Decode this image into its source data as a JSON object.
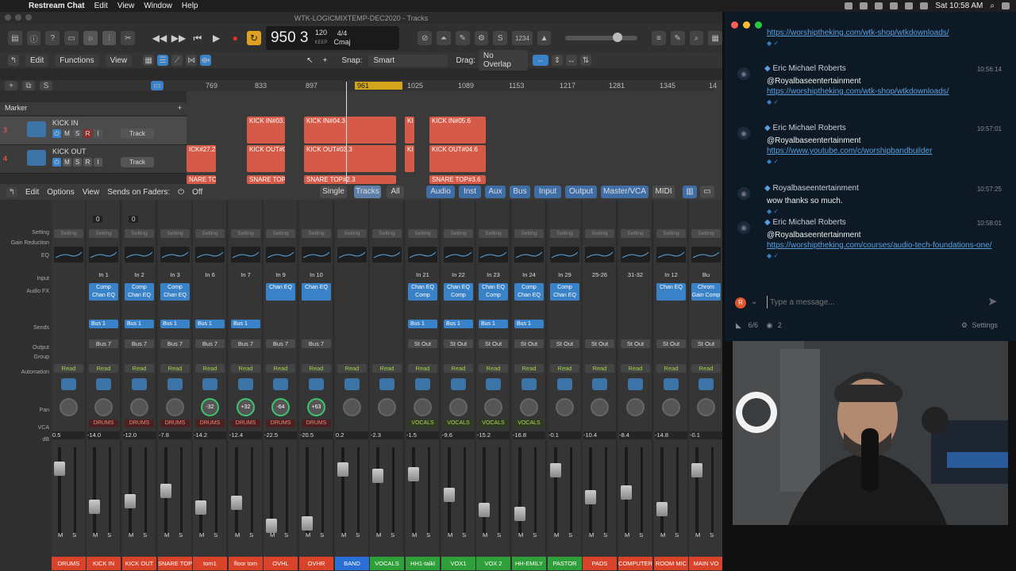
{
  "menubar": {
    "app": "Restream Chat",
    "items": [
      "Edit",
      "View",
      "Window",
      "Help"
    ],
    "time": "Sat 10:58 AM"
  },
  "logic": {
    "title": "WTK-LOGICMIXTEMP-DEC2020 - Tracks",
    "lcd": {
      "position": "950 3",
      "bar": "BAR",
      "beat": "BEAT",
      "tempo": "120",
      "keep": "KEEP",
      "tempo_label": "TEMPO",
      "sig": "4/4",
      "key": "Cmaj",
      "counter": "1234"
    },
    "edit": {
      "edit": "Edit",
      "functions": "Functions",
      "view": "View",
      "snap_label": "Snap:",
      "snap": "Smart",
      "drag_label": "Drag:",
      "drag": "No Overlap"
    },
    "ruler": [
      "769",
      "833",
      "897",
      "961",
      "1025",
      "1089",
      "1153",
      "1217",
      "1281",
      "1345",
      "14"
    ],
    "marker": "Marker",
    "tracks": [
      {
        "num": "3",
        "name": "KICK IN",
        "btn": "Track"
      },
      {
        "num": "4",
        "name": "KICK OUT",
        "btn": "Track"
      }
    ],
    "regions": [
      "KICK IN#03.",
      "KICK IN#04.3",
      "KI",
      "KICK IN#05.6",
      "ICK#27.2",
      "KICK OUT#0",
      "KICK OUT#03.3",
      "KI",
      "KICK OUT#04.6",
      "NARE TO",
      "SNARE TOP",
      "SNARE TOP#2.3",
      "SNARE TOP#3.6"
    ]
  },
  "mixer": {
    "bar": {
      "edit": "Edit",
      "options": "Options",
      "view": "View",
      "sends": "Sends on Faders:",
      "off": "Off",
      "single": "Single",
      "tracks": "Tracks",
      "all": "All",
      "tabs": [
        "Audio",
        "Inst",
        "Aux",
        "Bus",
        "Input",
        "Output",
        "Master/VCA",
        "MIDI"
      ]
    },
    "labels": [
      "Setting",
      "Gain Reduction",
      "EQ",
      "Input",
      "Audio FX",
      "Sends",
      "Output",
      "Group",
      "Automation",
      "Pan",
      "VCA",
      "dB"
    ],
    "gr_values": [
      "0",
      "0"
    ],
    "strips": [
      {
        "name": "DRUMS",
        "color": "#d9432a",
        "input": "",
        "fx": "",
        "send": "",
        "out": "",
        "auto": "Read",
        "vca": "",
        "db": "0.5",
        "pan": ""
      },
      {
        "name": "KICK IN",
        "color": "#d9432a",
        "input": "In 1",
        "fx": "Comp Chan EQ",
        "send": "Bus 1",
        "out": "Bus 7",
        "auto": "Read",
        "vca": "DRUMS",
        "db": "-14.0",
        "pan": ""
      },
      {
        "name": "KICK OUT",
        "color": "#d9432a",
        "input": "In 2",
        "fx": "Comp Chan EQ",
        "send": "Bus 1",
        "out": "Bus 7",
        "auto": "Read",
        "vca": "DRUMS",
        "db": "-12.0",
        "pan": ""
      },
      {
        "name": "SNARE TOP",
        "color": "#d9432a",
        "input": "In 3",
        "fx": "Comp Chan EQ",
        "send": "Bus 1",
        "out": "Bus 7",
        "auto": "Read",
        "vca": "DRUMS",
        "db": "-7.8",
        "pan": ""
      },
      {
        "name": "tom1",
        "color": "#d9432a",
        "input": "In 6",
        "fx": "",
        "send": "Bus 1",
        "out": "Bus 7",
        "auto": "Read",
        "vca": "DRUMS",
        "db": "-14.2",
        "pan": "-32"
      },
      {
        "name": "floor tom",
        "color": "#d9432a",
        "input": "In 7",
        "fx": "",
        "send": "Bus 1",
        "out": "Bus 7",
        "auto": "Read",
        "vca": "DRUMS",
        "db": "-12.4",
        "pan": "+32"
      },
      {
        "name": "OVHL",
        "color": "#d9432a",
        "input": "In 9",
        "fx": "Chan EQ",
        "send": "",
        "out": "Bus 7",
        "auto": "Read",
        "vca": "DRUMS",
        "db": "-22.5",
        "pan": "-64"
      },
      {
        "name": "OVHR",
        "color": "#d9432a",
        "input": "In 10",
        "fx": "Chan EQ",
        "send": "",
        "out": "Bus 7",
        "auto": "Read",
        "vca": "DRUMS",
        "db": "-20.5",
        "pan": "+63"
      },
      {
        "name": "BAND",
        "color": "#2a6fd6",
        "input": "",
        "fx": "",
        "send": "",
        "out": "",
        "auto": "Read",
        "vca": "",
        "db": "0.2",
        "pan": ""
      },
      {
        "name": "VOCALS",
        "color": "#2f9f3a",
        "input": "",
        "fx": "",
        "send": "",
        "out": "",
        "auto": "Read",
        "vca": "",
        "db": "-2.3",
        "pan": ""
      },
      {
        "name": "HH1-talkl",
        "color": "#2f9f3a",
        "input": "In 21",
        "fx": "Chan EQ Comp",
        "send": "Bus 1",
        "out": "St Out",
        "auto": "Read",
        "vca": "VOCALS",
        "db": "-1.5",
        "pan": ""
      },
      {
        "name": "VOX1",
        "color": "#2f9f3a",
        "input": "In 22",
        "fx": "Chan EQ Comp",
        "send": "Bus 1",
        "out": "St Out",
        "auto": "Read",
        "vca": "VOCALS",
        "db": "-9.6",
        "pan": ""
      },
      {
        "name": "VOX 2",
        "color": "#2f9f3a",
        "input": "In 23",
        "fx": "Chan EQ Comp",
        "send": "Bus 1",
        "out": "St Out",
        "auto": "Read",
        "vca": "VOCALS",
        "db": "-15.2",
        "pan": ""
      },
      {
        "name": "HH-EMILY",
        "color": "#2f9f3a",
        "input": "In 24",
        "fx": "Comp Chan EQ",
        "send": "Bus 1",
        "out": "St Out",
        "auto": "Read",
        "vca": "VOCALS",
        "db": "-16.8",
        "pan": ""
      },
      {
        "name": "PASTOR",
        "color": "#2f9f3a",
        "input": "In 29",
        "fx": "Comp Chan EQ",
        "send": "",
        "out": "St Out",
        "auto": "Read",
        "vca": "",
        "db": "-0.1",
        "pan": ""
      },
      {
        "name": "PADS",
        "color": "#d9432a",
        "input": "25-26",
        "fx": "",
        "send": "",
        "out": "St Out",
        "auto": "Read",
        "vca": "",
        "db": "-10.4",
        "pan": ""
      },
      {
        "name": "COMPUTER",
        "color": "#d9432a",
        "input": "31-32",
        "fx": "",
        "send": "",
        "out": "St Out",
        "auto": "Read",
        "vca": "",
        "db": "-8.4",
        "pan": ""
      },
      {
        "name": "ROOM MIC",
        "color": "#d9432a",
        "input": "In 12",
        "fx": "Chan EQ",
        "send": "",
        "out": "St Out",
        "auto": "Read",
        "vca": "",
        "db": "-14.8",
        "pan": ""
      },
      {
        "name": "MAIN VO",
        "color": "#d9432a",
        "input": "Bu",
        "fx": "Chrom Gain Comp",
        "send": "",
        "out": "St Out",
        "auto": "Read",
        "vca": "",
        "db": "-0.1",
        "pan": ""
      }
    ]
  },
  "chat": {
    "messages": [
      {
        "author": "",
        "time": "",
        "lines": [],
        "link": "https://worshiptheking.com/wtk-shop/wtkdownloads/"
      },
      {
        "author": "Eric Michael Roberts",
        "time": "10:56:14",
        "lines": [
          "@Royalbaseentertainment"
        ],
        "link": "https://worshiptheking.com/wtk-shop/wtkdownloads/"
      },
      {
        "author": "Eric Michael Roberts",
        "time": "10:57:01",
        "lines": [
          "@Royalbaseentertainment"
        ],
        "link": "https://www.youtube.com/c/worshipbandbuilder"
      },
      {
        "author": "Royalbaseentertainment",
        "time": "10:57:25",
        "lines": [
          "wow thanks so much."
        ],
        "link": ""
      },
      {
        "author": "Eric Michael Roberts",
        "time": "10:58:01",
        "lines": [
          "@Royalbaseentertainment"
        ],
        "link": "https://worshiptheking.com/courses/audio-tech-foundations-one/"
      }
    ],
    "input_placeholder": "Type a message...",
    "viewers": "6/6",
    "eye": "2",
    "settings": "Settings"
  }
}
